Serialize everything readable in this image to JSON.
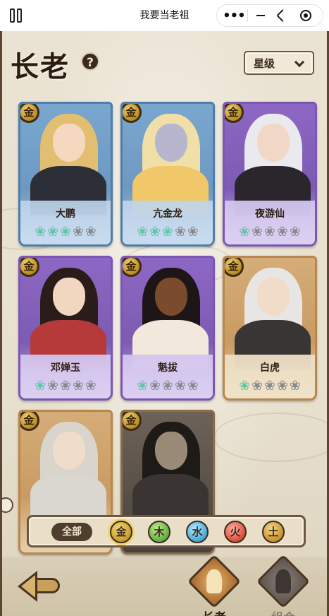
{
  "topbar": {
    "title": "我要当老祖",
    "more_icon": "more-dots-icon",
    "minimize_icon": "minimize-icon",
    "restore_icon": "restore-icon",
    "close_icon": "target-close-icon"
  },
  "header": {
    "title": "长老",
    "help_label": "?",
    "sort_label": "星级"
  },
  "cards": [
    {
      "name": "大鹏",
      "grade": "金",
      "stars_on": 3,
      "stars_total": 5,
      "frame": "blue"
    },
    {
      "name": "亢金龙",
      "grade": "金",
      "stars_on": 3,
      "stars_total": 5,
      "frame": "blue"
    },
    {
      "name": "夜游仙",
      "grade": "金",
      "stars_on": 1,
      "stars_total": 5,
      "frame": "purple"
    },
    {
      "name": "邓婵玉",
      "grade": "金",
      "stars_on": 1,
      "stars_total": 5,
      "frame": "purple"
    },
    {
      "name": "魁拔",
      "grade": "金",
      "stars_on": 1,
      "stars_total": 5,
      "frame": "purple"
    },
    {
      "name": "白虎",
      "grade": "金",
      "stars_on": 1,
      "stars_total": 5,
      "frame": "gold"
    },
    {
      "name": "",
      "grade": "金",
      "stars_on": 0,
      "stars_total": 0,
      "frame": "gold"
    },
    {
      "name": "",
      "grade": "金",
      "stars_on": 0,
      "stars_total": 0,
      "frame": "dark"
    }
  ],
  "filter": {
    "all_label": "全部",
    "elements": [
      "金",
      "木",
      "水",
      "火",
      "土"
    ],
    "selected": "金"
  },
  "nav": {
    "back_icon": "back-arrow-icon",
    "tabs": [
      {
        "label": "长老",
        "active": true
      },
      {
        "label": "组合",
        "active": false
      }
    ]
  },
  "colors": {
    "star_on": "#5ec7a7",
    "star_off": "#888a8f",
    "frame_blue": "#4f7eab",
    "frame_purple": "#7d56b4",
    "frame_gold": "#b8874d"
  }
}
